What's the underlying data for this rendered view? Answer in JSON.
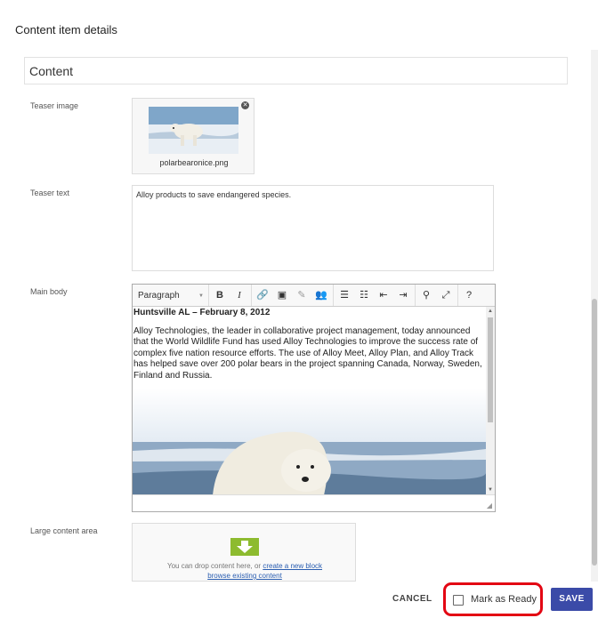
{
  "dialog": {
    "title": "Content item details"
  },
  "section": {
    "title": "Content"
  },
  "fields": {
    "teaser_image": {
      "label": "Teaser image",
      "file_name": "polarbearonice.png",
      "remove_icon": "close-circle-icon"
    },
    "teaser_text": {
      "label": "Teaser text",
      "value": "Alloy products to save endangered species."
    },
    "main_body": {
      "label": "Main body",
      "toolbar": {
        "format_select": "Paragraph",
        "buttons": [
          "bold",
          "italic",
          "link-icon",
          "image-icon",
          "edit-icon",
          "personalize-icon",
          "bulleted-list-icon",
          "numbered-list-icon",
          "outdent-icon",
          "indent-icon",
          "find-icon",
          "fullscreen-icon",
          "help-icon"
        ]
      },
      "headline": "Huntsville AL – February 8, 2012",
      "paragraph": "Alloy Technologies, the leader in collaborative project management, today announced that the World Wildlife Fund has used Alloy Technologies to improve the success rate of complex five nation resource efforts. The use of Alloy Meet, Alloy Plan, and Alloy Track has helped save over 200 polar bears in the project spanning Canada, Norway, Sweden, Finland and Russia."
    },
    "large_content_area": {
      "label": "Large content area",
      "drop_text": "You can drop content here, or",
      "create_link": "create a new block",
      "browse_link": "browse existing content"
    }
  },
  "footer": {
    "cancel_label": "CANCEL",
    "ready_label": "Mark as Ready",
    "ready_checked": false,
    "save_label": "SAVE",
    "colors": {
      "save": "#3b4ba8",
      "highlight": "#e30613",
      "drop_icon": "#8dbb2f"
    }
  }
}
